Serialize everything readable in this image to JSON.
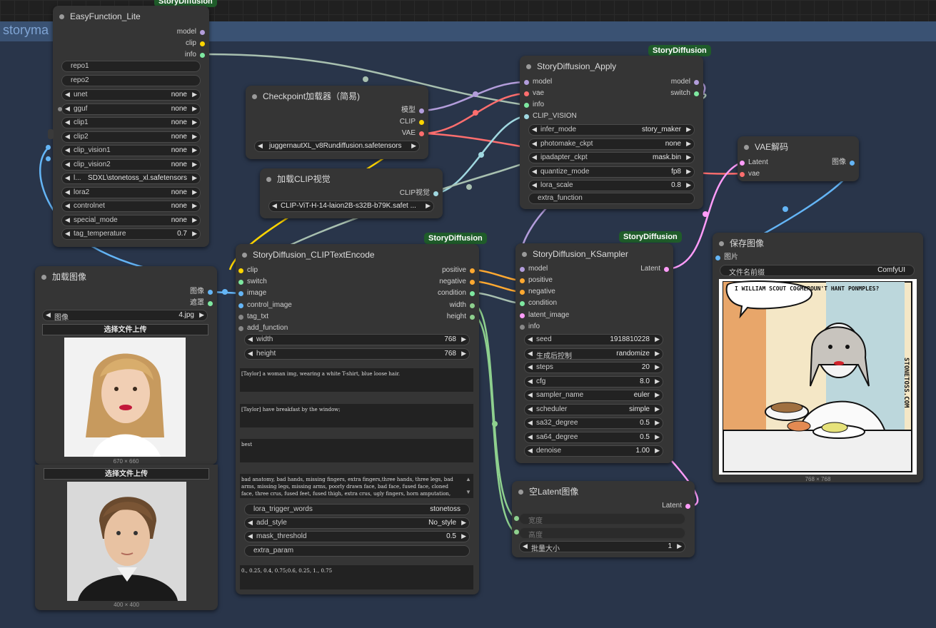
{
  "group": {
    "title": "storyma",
    "top_badge": "StoryDiffusion"
  },
  "colors": {
    "model": "#b39ddb",
    "clip": "#ffd500",
    "vae": "#ff6e6e",
    "image": "#64b5f6",
    "latent": "#ff9cf9",
    "info": "#7ee8a0",
    "cond": "#ffa931",
    "int": "#8ed08e",
    "misc": "#a0d8e0"
  },
  "easy": {
    "title": "EasyFunction_Lite",
    "outputs": [
      "model",
      "clip",
      "info"
    ],
    "repo1": "repo1",
    "repo2": "repo2",
    "widgets": [
      {
        "label": "unet",
        "value": "none"
      },
      {
        "label": "gguf",
        "value": "none"
      },
      {
        "label": "clip1",
        "value": "none"
      },
      {
        "label": "clip2",
        "value": "none"
      },
      {
        "label": "clip_vision1",
        "value": "none"
      },
      {
        "label": "clip_vision2",
        "value": "none"
      },
      {
        "label": "l...",
        "value": "SDXL\\stonetoss_xl.safetensors"
      },
      {
        "label": "lora2",
        "value": "none"
      },
      {
        "label": "controlnet",
        "value": "none"
      },
      {
        "label": "special_mode",
        "value": "none"
      },
      {
        "label": "tag_temperature",
        "value": "0.7"
      }
    ]
  },
  "ckpt": {
    "title": "Checkpoint加载器（简易)",
    "outputs": [
      "模型",
      "CLIP",
      "VAE"
    ],
    "value": "juggernautXL_v8Rundiffusion.safetensors"
  },
  "clipvis": {
    "title": "加载CLIP视觉",
    "output": "CLIP视觉",
    "value": "CLIP-ViT-H-14-laion2B-s32B-b79K.safet ..."
  },
  "apply": {
    "title": "StoryDiffusion_Apply",
    "badge": "StoryDiffusion",
    "inputs": [
      "model",
      "vae",
      "info",
      "CLIP_VISION"
    ],
    "outputs": [
      "model",
      "switch"
    ],
    "widgets": [
      {
        "label": "infer_mode",
        "value": "story_maker"
      },
      {
        "label": "photomake_ckpt",
        "value": "none"
      },
      {
        "label": "ipadapter_ckpt",
        "value": "mask.bin"
      },
      {
        "label": "quantize_mode",
        "value": "fp8"
      },
      {
        "label": "lora_scale",
        "value": "0.8"
      }
    ],
    "extra": "extra_function"
  },
  "vae": {
    "title": "VAE解码",
    "inputs": [
      "Latent",
      "vae"
    ],
    "output": "图像"
  },
  "load1": {
    "title": "加载图像",
    "outputs": [
      "图像",
      "遮罩"
    ],
    "label": "图像",
    "value": "4.jpg",
    "upload": "选择文件上传",
    "caption": "670 × 660"
  },
  "load2": {
    "upload": "选择文件上传",
    "caption": "400 × 400"
  },
  "encode": {
    "title": "StoryDiffusion_CLIPTextEncode",
    "badge": "StoryDiffusion",
    "inputs": [
      "clip",
      "switch",
      "image",
      "control_image",
      "tag_txt",
      "add_function"
    ],
    "outputs": [
      "positive",
      "negative",
      "condition",
      "width",
      "height"
    ],
    "width": {
      "label": "width",
      "value": "768"
    },
    "height": {
      "label": "height",
      "value": "768"
    },
    "prompt1": "[Taylor] a woman img, wearing a white T-shirt, blue loose hair.",
    "prompt2": "[Taylor] have breakfast by the window;",
    "prompt3": "best",
    "negative": "bad anatomy, bad hands, missing fingers, extra fingers,three hands, three legs, bad arms, missing legs, missing arms, poorly drawn face, bad face, fused face, cloned face, three crus, fused feet, fused thigh, extra crus, ugly fingers, horn amputation, disconnected limbs",
    "lora_trigger": {
      "label": "lora_trigger_words",
      "value": "stonetoss"
    },
    "add_style": {
      "label": "add_style",
      "value": "No_style"
    },
    "mask_threshold": {
      "label": "mask_threshold",
      "value": "0.5"
    },
    "extra_param": "extra_param",
    "coords": "0., 0.25, 0.4, 0.75;0.6, 0.25, 1., 0.75"
  },
  "ksampler": {
    "title": "StoryDiffusion_KSampler",
    "badge": "StoryDiffusion",
    "inputs": [
      "model",
      "positive",
      "negative",
      "condition",
      "latent_image",
      "info"
    ],
    "output": "Latent",
    "widgets": [
      {
        "label": "seed",
        "value": "1918810228"
      },
      {
        "label": "生成后控制",
        "value": "randomize"
      },
      {
        "label": "steps",
        "value": "20"
      },
      {
        "label": "cfg",
        "value": "8.0"
      },
      {
        "label": "sampler_name",
        "value": "euler"
      },
      {
        "label": "scheduler",
        "value": "simple"
      },
      {
        "label": "sa32_degree",
        "value": "0.5"
      },
      {
        "label": "sa64_degree",
        "value": "0.5"
      },
      {
        "label": "denoise",
        "value": "1.00"
      }
    ]
  },
  "latent": {
    "title": "空Latent图像",
    "output": "Latent",
    "width": "宽度",
    "height": "高度",
    "batch": {
      "label": "批量大小",
      "value": "1"
    }
  },
  "save": {
    "title": "保存图像",
    "input": "图片",
    "prefix": {
      "label": "文件名前缀",
      "value": "ComfyUI"
    },
    "speech": "I WILLIAM SCOUT COGMEROUN'T HANT PONMPLES?",
    "signature": "STONETOSS.COM",
    "caption": "768 × 768"
  }
}
